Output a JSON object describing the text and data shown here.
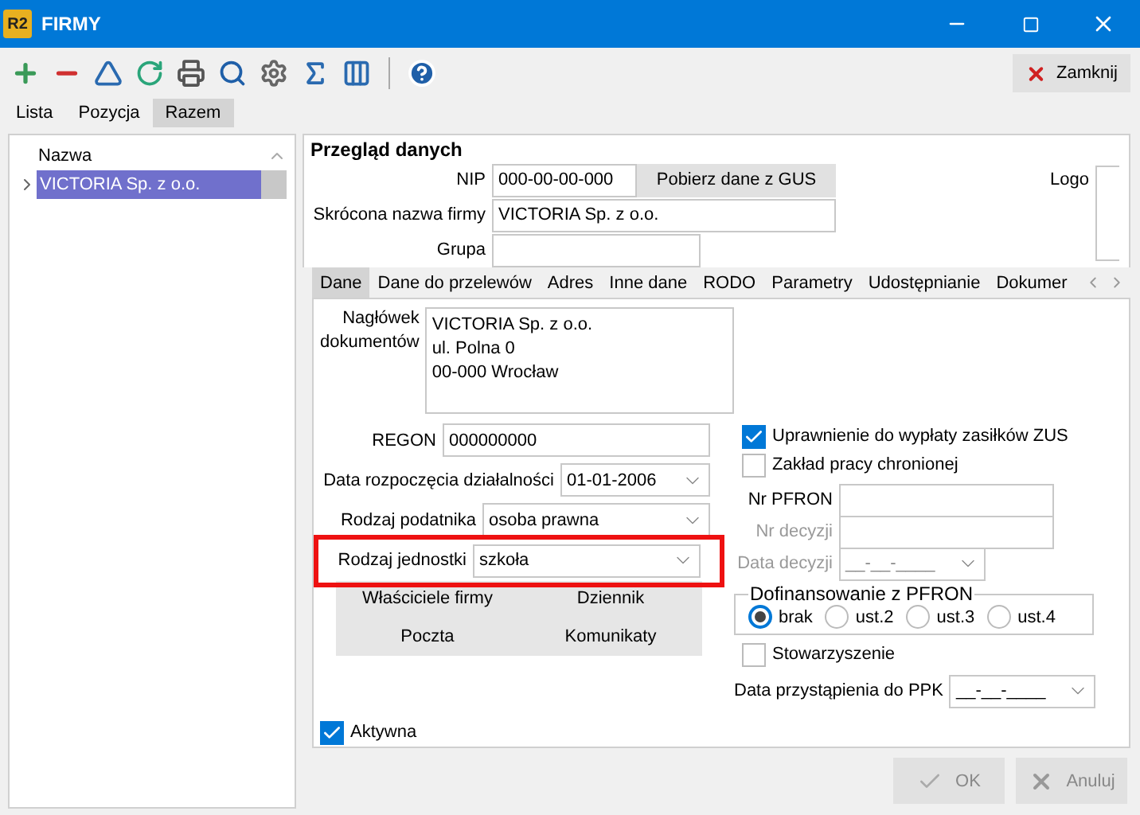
{
  "window": {
    "title": "FIRMY",
    "app_badge": "R2"
  },
  "toolbar": {
    "close_button": "Zamknij"
  },
  "view_tabs": [
    {
      "label": "Lista",
      "selected": false
    },
    {
      "label": "Pozycja",
      "selected": false
    },
    {
      "label": "Razem",
      "selected": true
    }
  ],
  "list": {
    "column": "Nazwa",
    "rows": [
      {
        "name": "VICTORIA Sp. z o.o.",
        "selected": true
      }
    ]
  },
  "overview": {
    "title": "Przegląd danych",
    "logo_label": "Logo",
    "gus_button": "Pobierz dane z GUS",
    "fields": [
      {
        "label": "NIP",
        "value": "000-00-00-000",
        "kind": "nip"
      },
      {
        "label": "Skrócona nazwa firmy",
        "value": "VICTORIA Sp. z o.o.",
        "kind": "wide"
      },
      {
        "label": "Grupa",
        "kind": "short"
      }
    ]
  },
  "detail_tabs": [
    {
      "label": "Dane",
      "selected": true
    },
    {
      "label": "Dane do przelewów",
      "selected": false
    },
    {
      "label": "Adres",
      "selected": false
    },
    {
      "label": "Inne dane",
      "selected": false
    },
    {
      "label": "RODO",
      "selected": false
    },
    {
      "label": "Parametry",
      "selected": false
    },
    {
      "label": "Udostępnianie",
      "selected": false
    },
    {
      "label": "Dokumer",
      "selected": false
    }
  ],
  "header_field": {
    "label": "Nagłówek dokumentów",
    "lines": [
      "VICTORIA Sp. z o.o.",
      "ul. Polna 0",
      "00-000 Wrocław"
    ]
  },
  "left_fields": [
    {
      "label": "REGON",
      "value": "000000000",
      "kind": "text",
      "highlighted": false
    },
    {
      "label": "Data rozpoczęcia działalności",
      "value": "01-01-2006",
      "kind": "dropdown",
      "highlighted": false
    },
    {
      "label": "Rodzaj podatnika",
      "value": "osoba prawna",
      "kind": "dropdown",
      "highlighted": false
    },
    {
      "label": "Rodzaj jednostki",
      "value": "szkoła",
      "kind": "dropdown",
      "highlighted": true
    }
  ],
  "link_buttons": [
    "Właściciele firmy",
    "Dziennik",
    "Poczta",
    "Komunikaty"
  ],
  "active_checkbox": {
    "label": "Aktywna",
    "checked": true
  },
  "right_checkboxes": [
    {
      "label": "Uprawnienie do wypłaty zasiłków ZUS",
      "checked": true
    },
    {
      "label": "Zakład pracy chronionej",
      "checked": false
    }
  ],
  "pfron_fields": [
    {
      "label": "Nr PFRON",
      "kind": "text",
      "disabled": false
    },
    {
      "label": "Nr decyzji",
      "kind": "text",
      "disabled": true
    },
    {
      "label": "Data decyzji",
      "value": "__-__-____",
      "kind": "dropdown",
      "disabled": true
    }
  ],
  "pfron_group": {
    "title": "Dofinansowanie z PFRON",
    "options": [
      {
        "label": "brak",
        "selected": true
      },
      {
        "label": "ust.2",
        "selected": false
      },
      {
        "label": "ust.3",
        "selected": false
      },
      {
        "label": "ust.4",
        "selected": false
      }
    ]
  },
  "association": {
    "label": "Stowarzyszenie",
    "checked": false
  },
  "ppk_field": {
    "label": "Data przystąpienia do PPK",
    "value": "__-__-____"
  },
  "footer_buttons": [
    {
      "label": "OK",
      "kind": "ok",
      "disabled": true
    },
    {
      "label": "Anuluj",
      "kind": "cancel",
      "disabled": true
    }
  ]
}
